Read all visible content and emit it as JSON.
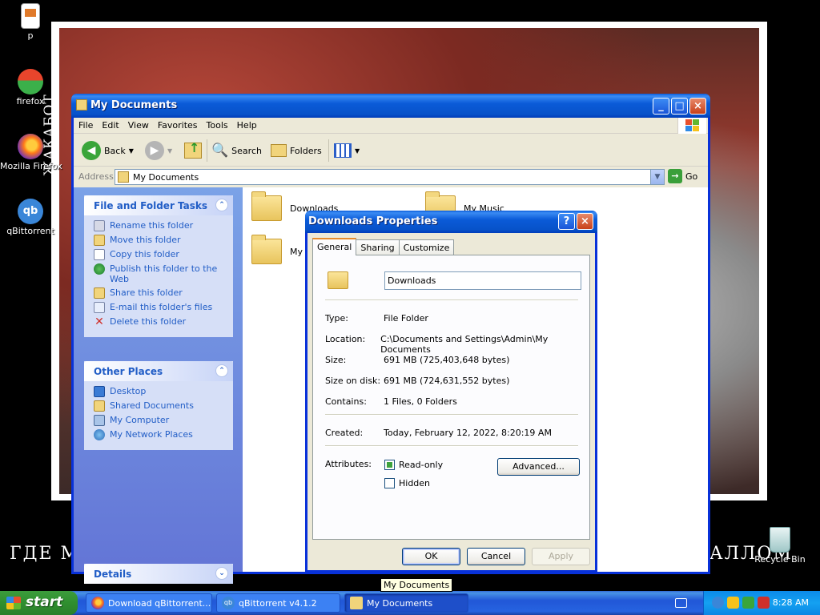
{
  "desktop": {
    "icons": [
      {
        "label": "p"
      },
      {
        "label": "firefox"
      },
      {
        "label": "Mozilla Firefox"
      },
      {
        "label": "qBittorrent"
      }
    ],
    "recycle_bin": "Recycle Bin",
    "wallpaper_side_text": "ЖАКАБОТ",
    "wallpaper_bottom_left": "ГДЕ М",
    "wallpaper_bottom_right": "АЛЛОМ"
  },
  "explorer": {
    "title": "My Documents",
    "menu": [
      "File",
      "Edit",
      "View",
      "Favorites",
      "Tools",
      "Help"
    ],
    "toolbar": {
      "back": "Back",
      "search": "Search",
      "folders": "Folders"
    },
    "address": {
      "label": "Address",
      "value": "My Documents",
      "go": "Go"
    },
    "tasks_panel": {
      "title": "File and Folder Tasks",
      "items": [
        "Rename this folder",
        "Move this folder",
        "Copy this folder",
        "Publish this folder to the Web",
        "Share this folder",
        "E-mail this folder's files",
        "Delete this folder"
      ]
    },
    "places_panel": {
      "title": "Other Places",
      "items": [
        "Desktop",
        "Shared Documents",
        "My Computer",
        "My Network Places"
      ]
    },
    "details_panel": {
      "title": "Details"
    },
    "files": [
      {
        "name": "Downloads"
      },
      {
        "name": "My Music"
      },
      {
        "name": "My P"
      }
    ]
  },
  "dialog": {
    "title": "Downloads Properties",
    "tabs": [
      "General",
      "Sharing",
      "Customize"
    ],
    "name_value": "Downloads",
    "type_label": "Type:",
    "type_value": "File Folder",
    "location_label": "Location:",
    "location_value": "C:\\Documents and Settings\\Admin\\My Documents",
    "size_label": "Size:",
    "size_value": "691 MB (725,403,648 bytes)",
    "size_on_disk_label": "Size on disk:",
    "size_on_disk_value": "691 MB (724,631,552 bytes)",
    "contains_label": "Contains:",
    "contains_value": "1 Files, 0 Folders",
    "created_label": "Created:",
    "created_value": "Today, February 12, 2022, 8:20:19 AM",
    "attributes_label": "Attributes:",
    "readonly_label": "Read-only",
    "hidden_label": "Hidden",
    "advanced_button": "Advanced...",
    "ok_button": "OK",
    "cancel_button": "Cancel",
    "apply_button": "Apply"
  },
  "tooltip": "My Documents",
  "taskbar": {
    "start": "start",
    "tasks": [
      {
        "label": "Download qBittorrent..."
      },
      {
        "label": "qBittorrent v4.1.2"
      },
      {
        "label": "My Documents"
      }
    ],
    "clock": "8:28 AM"
  }
}
